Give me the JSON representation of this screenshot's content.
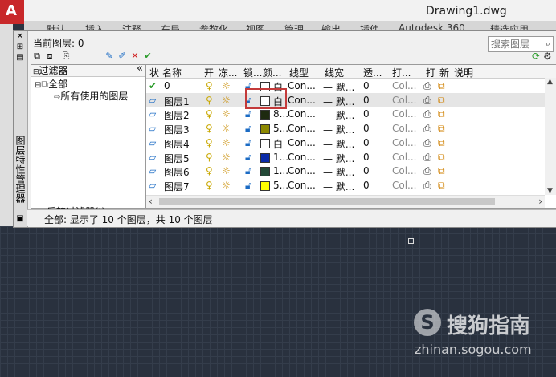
{
  "app": {
    "logo": "A",
    "document_title": "Drawing1.dwg"
  },
  "ribbon": {
    "tabs": [
      "默认",
      "插入",
      "注释",
      "布局",
      "参数化",
      "视图",
      "管理",
      "输出",
      "插件",
      "Autodesk 360",
      "精选应用"
    ]
  },
  "palette": {
    "vertical_title": "图层特性管理器",
    "current_layer": "当前图层: 0",
    "search_placeholder": "搜索图层",
    "filter_panel": {
      "header": "过滤器",
      "collapse": "«",
      "tree": [
        {
          "label": "全部",
          "level": 0
        },
        {
          "label": "所有使用的图层",
          "level": 1
        }
      ],
      "invert_label": "反转过滤器(I)",
      "invert_checked": false
    },
    "columns": [
      "状",
      "名称",
      "开",
      "冻...",
      "锁...",
      "颜...",
      "线型",
      "线宽",
      "透...",
      "打...",
      "打",
      "新",
      "说明"
    ],
    "rows": [
      {
        "status": "current",
        "name": "0",
        "color_name": "白",
        "color": "#ffffff",
        "linetype": "Con...",
        "lineweight": "— 默...",
        "transparency": "0",
        "plot_style": "Col..."
      },
      {
        "status": "layer",
        "name": "图层1",
        "color_name": "白",
        "color": "#ffffff",
        "linetype": "Con...",
        "lineweight": "— 默...",
        "transparency": "0",
        "plot_style": "Col...",
        "selected": true
      },
      {
        "status": "layer",
        "name": "图层2",
        "color_name": "8...",
        "color": "#1e2a10",
        "linetype": "Con...",
        "lineweight": "— 默...",
        "transparency": "0",
        "plot_style": "Col..."
      },
      {
        "status": "layer",
        "name": "图层3",
        "color_name": "5...",
        "color": "#8c8800",
        "linetype": "Con...",
        "lineweight": "— 默...",
        "transparency": "0",
        "plot_style": "Col..."
      },
      {
        "status": "layer",
        "name": "图层4",
        "color_name": "白",
        "color": "#ffffff",
        "linetype": "Con...",
        "lineweight": "— 默...",
        "transparency": "0",
        "plot_style": "Col..."
      },
      {
        "status": "layer",
        "name": "图层5",
        "color_name": "1...",
        "color": "#0a2aa8",
        "linetype": "Con...",
        "lineweight": "— 默...",
        "transparency": "0",
        "plot_style": "Col..."
      },
      {
        "status": "layer",
        "name": "图层6",
        "color_name": "1...",
        "color": "#244a38",
        "linetype": "Con...",
        "lineweight": "— 默...",
        "transparency": "0",
        "plot_style": "Col..."
      },
      {
        "status": "layer",
        "name": "图层7",
        "color_name": "5...",
        "color": "#ffff00",
        "linetype": "Con...",
        "lineweight": "— 默...",
        "transparency": "0",
        "plot_style": "Col..."
      }
    ],
    "status_bar": "全部: 显示了 10 个图层，共 10 个图层"
  },
  "watermark": {
    "logo_glyph": "S",
    "name": "搜狗指南",
    "url": "zhinan.sogou.com"
  }
}
